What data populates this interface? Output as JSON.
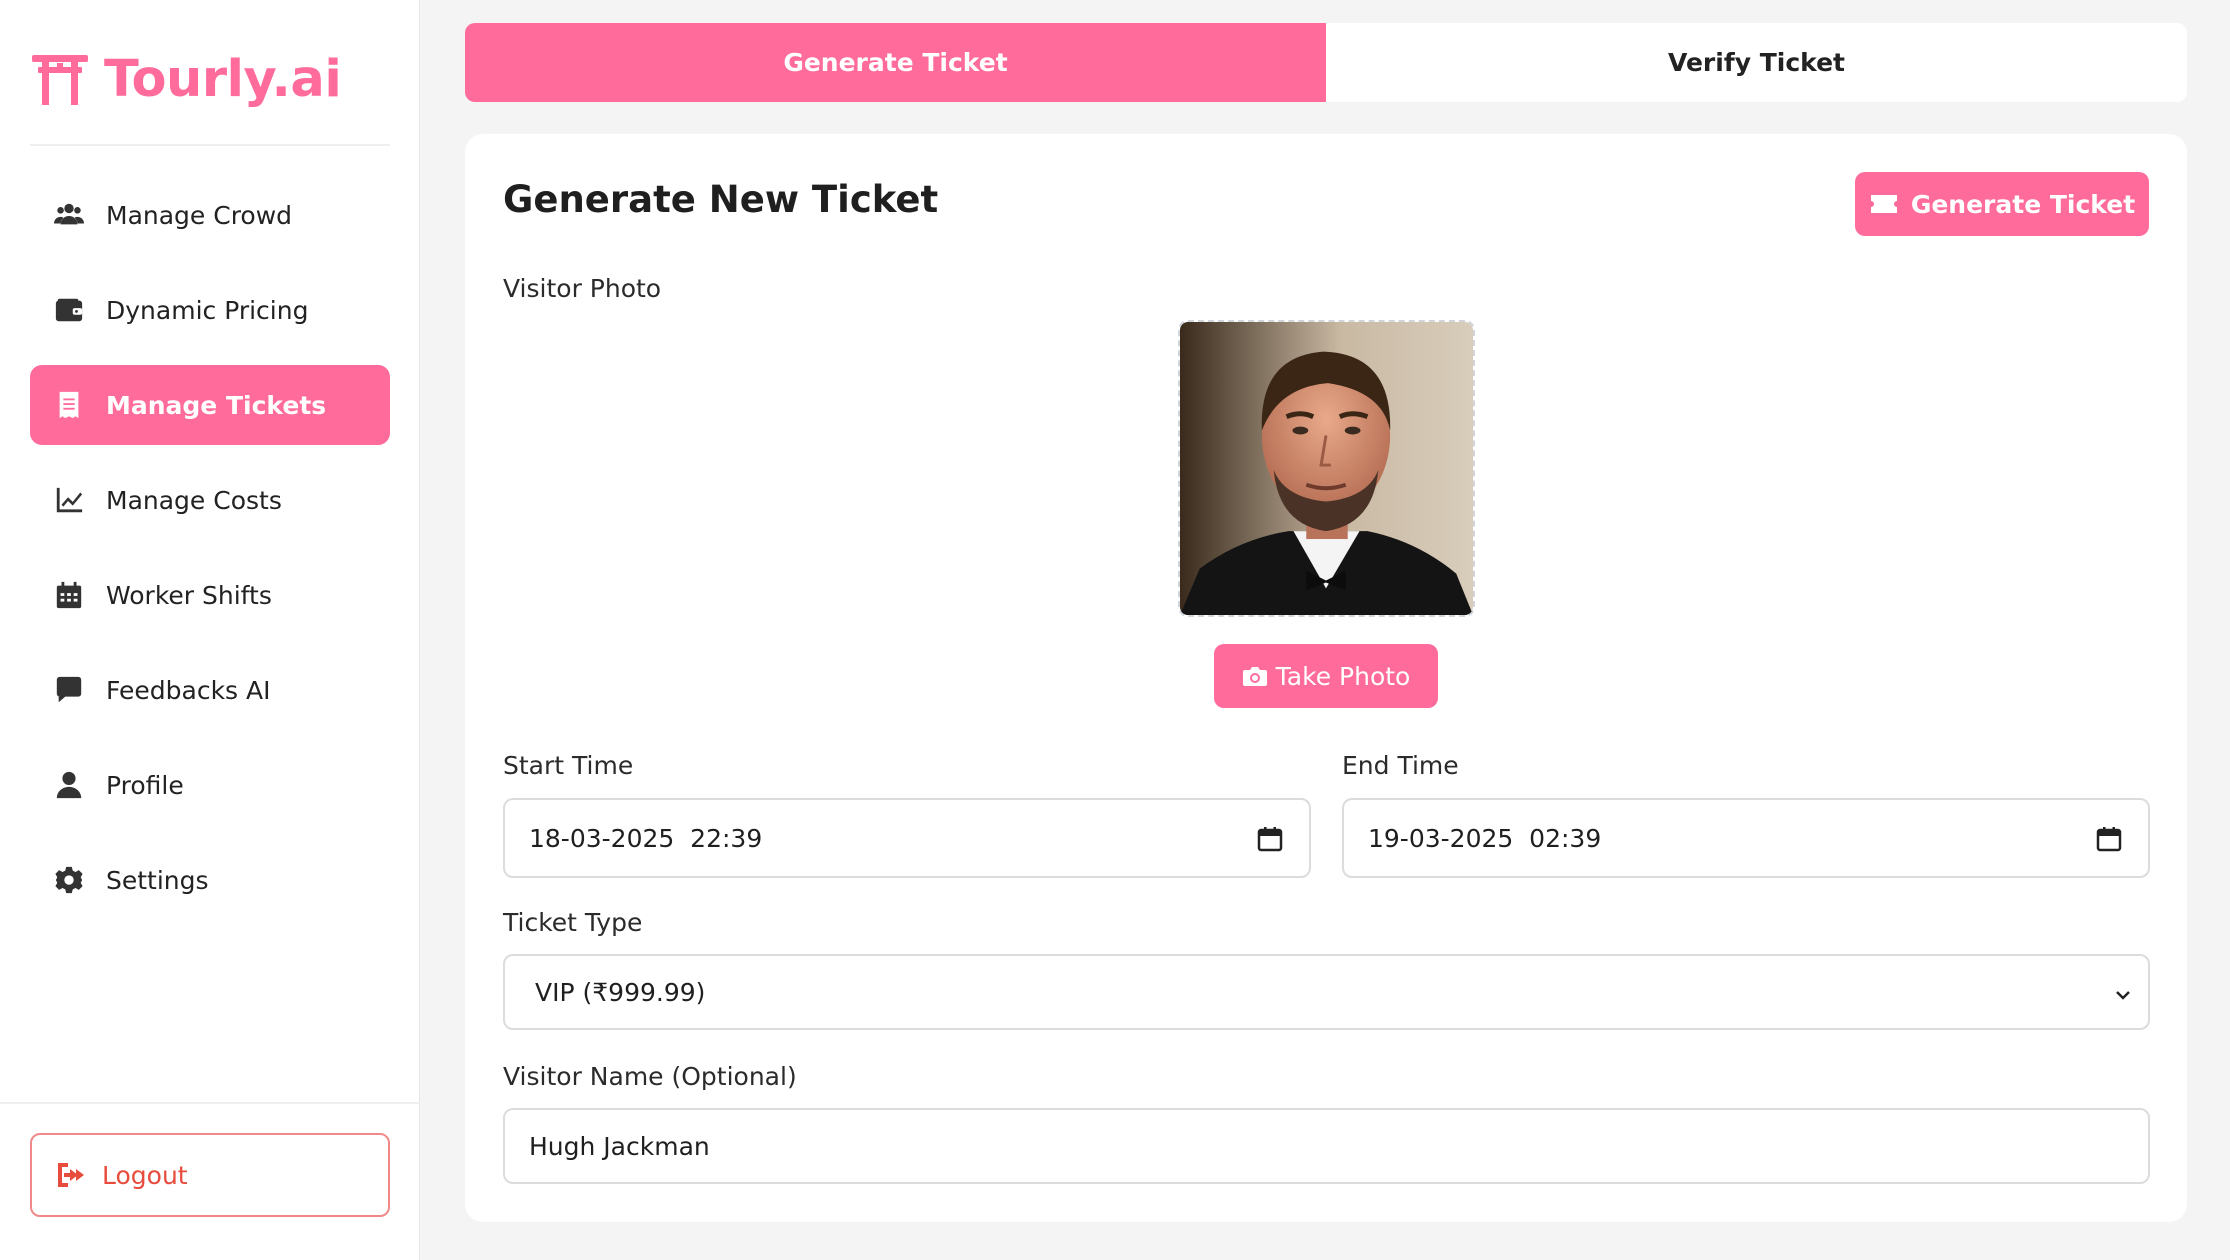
{
  "brand": {
    "name": "Tourly.ai",
    "accent": "#ff6b9a"
  },
  "sidebar": {
    "items": [
      {
        "label": "Manage Crowd",
        "icon": "users-icon",
        "active": false
      },
      {
        "label": "Dynamic Pricing",
        "icon": "wallet-icon",
        "active": false
      },
      {
        "label": "Manage Tickets",
        "icon": "receipt-icon",
        "active": true
      },
      {
        "label": "Manage Costs",
        "icon": "line-chart-icon",
        "active": false
      },
      {
        "label": "Worker Shifts",
        "icon": "calendar-icon",
        "active": false
      },
      {
        "label": "Feedbacks AI",
        "icon": "comment-icon",
        "active": false
      },
      {
        "label": "Profile",
        "icon": "user-icon",
        "active": false
      },
      {
        "label": "Settings",
        "icon": "gear-icon",
        "active": false
      }
    ],
    "logout": {
      "label": "Logout",
      "icon": "sign-out-icon",
      "color": "#e74c3c"
    }
  },
  "tabs": [
    {
      "label": "Generate Ticket",
      "active": true
    },
    {
      "label": "Verify Ticket",
      "active": false
    }
  ],
  "card": {
    "title": "Generate New Ticket",
    "generate_button": "Generate Ticket",
    "photo_label": "Visitor Photo",
    "take_photo_button": "Take Photo",
    "start_time": {
      "label": "Start Time",
      "value": "18-03-2025  22:39"
    },
    "end_time": {
      "label": "End Time",
      "value": "19-03-2025  02:39"
    },
    "ticket_type": {
      "label": "Ticket Type",
      "value": "VIP (₹999.99)"
    },
    "visitor_name": {
      "label": "Visitor Name (Optional)",
      "value": "Hugh Jackman"
    }
  }
}
